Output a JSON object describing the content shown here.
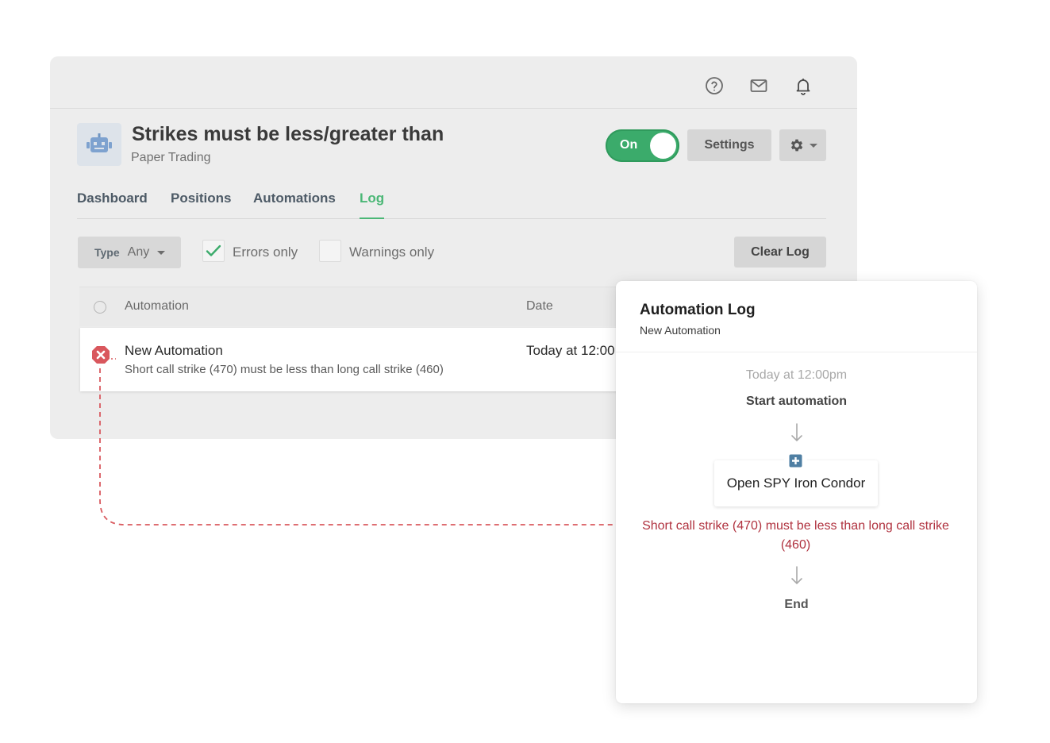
{
  "app": {
    "title": "Strikes must be less/greater than",
    "subtitle": "Paper Trading",
    "toggle_label": "On",
    "settings_label": "Settings",
    "topbar_icons": [
      "help-icon",
      "mail-icon",
      "bell-icon"
    ]
  },
  "tabs": [
    {
      "label": "Dashboard",
      "active": false
    },
    {
      "label": "Positions",
      "active": false
    },
    {
      "label": "Automations",
      "active": false
    },
    {
      "label": "Log",
      "active": true
    }
  ],
  "filters": {
    "type_label": "Type",
    "type_value": "Any",
    "errors_only_label": "Errors only",
    "errors_only_checked": true,
    "warnings_only_label": "Warnings only",
    "warnings_only_checked": false,
    "clear_label": "Clear Log"
  },
  "table": {
    "columns": [
      "Automation",
      "Date"
    ],
    "rows": [
      {
        "title": "New Automation",
        "message": "Short call strike (470) must be less than long call strike (460)",
        "date": "Today at 12:00"
      }
    ]
  },
  "log_panel": {
    "title": "Automation Log",
    "subtitle": "New Automation",
    "time": "Today at 12:00pm",
    "start": "Start automation",
    "step": "Open SPY Iron Condor",
    "error": "Short call strike (470) must be less than long call strike (460)",
    "end": "End"
  },
  "colors": {
    "accent_green": "#4bb776",
    "toggle_green": "#3bab6b",
    "error_red": "#b0323f",
    "connector_red": "#d95a5f"
  }
}
